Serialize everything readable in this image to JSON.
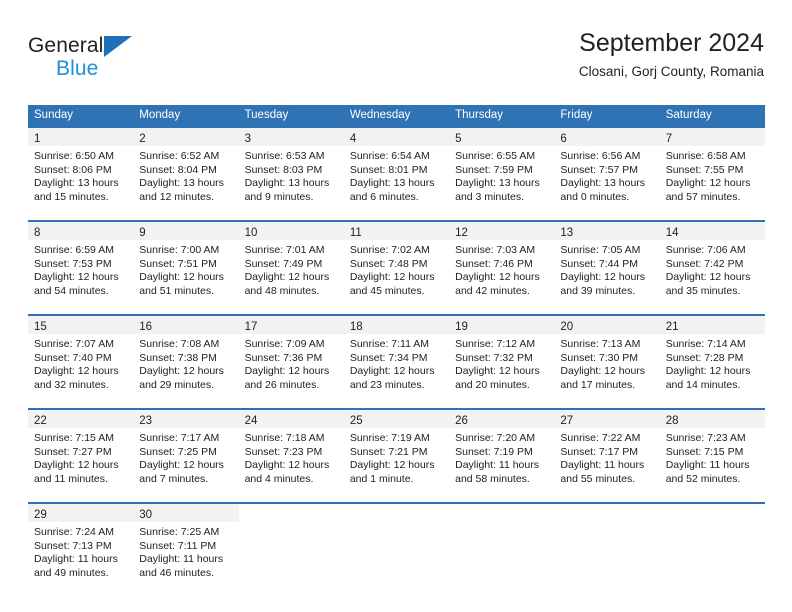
{
  "brand": {
    "name_top": "General",
    "name_bottom": "Blue",
    "triangle_color": "#1d71b8",
    "bottom_color": "#1d8fd6"
  },
  "header": {
    "title": "September 2024",
    "subtitle": "Closani, Gorj County, Romania"
  },
  "theme": {
    "header_blue": "#3073b5",
    "daynum_band": "#f2f2f2",
    "text": "#222222"
  },
  "weekdays": [
    "Sunday",
    "Monday",
    "Tuesday",
    "Wednesday",
    "Thursday",
    "Friday",
    "Saturday"
  ],
  "weeks": [
    [
      {
        "day": "1",
        "sunrise": "Sunrise: 6:50 AM",
        "sunset": "Sunset: 8:06 PM",
        "daylight1": "Daylight: 13 hours",
        "daylight2": "and 15 minutes."
      },
      {
        "day": "2",
        "sunrise": "Sunrise: 6:52 AM",
        "sunset": "Sunset: 8:04 PM",
        "daylight1": "Daylight: 13 hours",
        "daylight2": "and 12 minutes."
      },
      {
        "day": "3",
        "sunrise": "Sunrise: 6:53 AM",
        "sunset": "Sunset: 8:03 PM",
        "daylight1": "Daylight: 13 hours",
        "daylight2": "and 9 minutes."
      },
      {
        "day": "4",
        "sunrise": "Sunrise: 6:54 AM",
        "sunset": "Sunset: 8:01 PM",
        "daylight1": "Daylight: 13 hours",
        "daylight2": "and 6 minutes."
      },
      {
        "day": "5",
        "sunrise": "Sunrise: 6:55 AM",
        "sunset": "Sunset: 7:59 PM",
        "daylight1": "Daylight: 13 hours",
        "daylight2": "and 3 minutes."
      },
      {
        "day": "6",
        "sunrise": "Sunrise: 6:56 AM",
        "sunset": "Sunset: 7:57 PM",
        "daylight1": "Daylight: 13 hours",
        "daylight2": "and 0 minutes."
      },
      {
        "day": "7",
        "sunrise": "Sunrise: 6:58 AM",
        "sunset": "Sunset: 7:55 PM",
        "daylight1": "Daylight: 12 hours",
        "daylight2": "and 57 minutes."
      }
    ],
    [
      {
        "day": "8",
        "sunrise": "Sunrise: 6:59 AM",
        "sunset": "Sunset: 7:53 PM",
        "daylight1": "Daylight: 12 hours",
        "daylight2": "and 54 minutes."
      },
      {
        "day": "9",
        "sunrise": "Sunrise: 7:00 AM",
        "sunset": "Sunset: 7:51 PM",
        "daylight1": "Daylight: 12 hours",
        "daylight2": "and 51 minutes."
      },
      {
        "day": "10",
        "sunrise": "Sunrise: 7:01 AM",
        "sunset": "Sunset: 7:49 PM",
        "daylight1": "Daylight: 12 hours",
        "daylight2": "and 48 minutes."
      },
      {
        "day": "11",
        "sunrise": "Sunrise: 7:02 AM",
        "sunset": "Sunset: 7:48 PM",
        "daylight1": "Daylight: 12 hours",
        "daylight2": "and 45 minutes."
      },
      {
        "day": "12",
        "sunrise": "Sunrise: 7:03 AM",
        "sunset": "Sunset: 7:46 PM",
        "daylight1": "Daylight: 12 hours",
        "daylight2": "and 42 minutes."
      },
      {
        "day": "13",
        "sunrise": "Sunrise: 7:05 AM",
        "sunset": "Sunset: 7:44 PM",
        "daylight1": "Daylight: 12 hours",
        "daylight2": "and 39 minutes."
      },
      {
        "day": "14",
        "sunrise": "Sunrise: 7:06 AM",
        "sunset": "Sunset: 7:42 PM",
        "daylight1": "Daylight: 12 hours",
        "daylight2": "and 35 minutes."
      }
    ],
    [
      {
        "day": "15",
        "sunrise": "Sunrise: 7:07 AM",
        "sunset": "Sunset: 7:40 PM",
        "daylight1": "Daylight: 12 hours",
        "daylight2": "and 32 minutes."
      },
      {
        "day": "16",
        "sunrise": "Sunrise: 7:08 AM",
        "sunset": "Sunset: 7:38 PM",
        "daylight1": "Daylight: 12 hours",
        "daylight2": "and 29 minutes."
      },
      {
        "day": "17",
        "sunrise": "Sunrise: 7:09 AM",
        "sunset": "Sunset: 7:36 PM",
        "daylight1": "Daylight: 12 hours",
        "daylight2": "and 26 minutes."
      },
      {
        "day": "18",
        "sunrise": "Sunrise: 7:11 AM",
        "sunset": "Sunset: 7:34 PM",
        "daylight1": "Daylight: 12 hours",
        "daylight2": "and 23 minutes."
      },
      {
        "day": "19",
        "sunrise": "Sunrise: 7:12 AM",
        "sunset": "Sunset: 7:32 PM",
        "daylight1": "Daylight: 12 hours",
        "daylight2": "and 20 minutes."
      },
      {
        "day": "20",
        "sunrise": "Sunrise: 7:13 AM",
        "sunset": "Sunset: 7:30 PM",
        "daylight1": "Daylight: 12 hours",
        "daylight2": "and 17 minutes."
      },
      {
        "day": "21",
        "sunrise": "Sunrise: 7:14 AM",
        "sunset": "Sunset: 7:28 PM",
        "daylight1": "Daylight: 12 hours",
        "daylight2": "and 14 minutes."
      }
    ],
    [
      {
        "day": "22",
        "sunrise": "Sunrise: 7:15 AM",
        "sunset": "Sunset: 7:27 PM",
        "daylight1": "Daylight: 12 hours",
        "daylight2": "and 11 minutes."
      },
      {
        "day": "23",
        "sunrise": "Sunrise: 7:17 AM",
        "sunset": "Sunset: 7:25 PM",
        "daylight1": "Daylight: 12 hours",
        "daylight2": "and 7 minutes."
      },
      {
        "day": "24",
        "sunrise": "Sunrise: 7:18 AM",
        "sunset": "Sunset: 7:23 PM",
        "daylight1": "Daylight: 12 hours",
        "daylight2": "and 4 minutes."
      },
      {
        "day": "25",
        "sunrise": "Sunrise: 7:19 AM",
        "sunset": "Sunset: 7:21 PM",
        "daylight1": "Daylight: 12 hours",
        "daylight2": "and 1 minute."
      },
      {
        "day": "26",
        "sunrise": "Sunrise: 7:20 AM",
        "sunset": "Sunset: 7:19 PM",
        "daylight1": "Daylight: 11 hours",
        "daylight2": "and 58 minutes."
      },
      {
        "day": "27",
        "sunrise": "Sunrise: 7:22 AM",
        "sunset": "Sunset: 7:17 PM",
        "daylight1": "Daylight: 11 hours",
        "daylight2": "and 55 minutes."
      },
      {
        "day": "28",
        "sunrise": "Sunrise: 7:23 AM",
        "sunset": "Sunset: 7:15 PM",
        "daylight1": "Daylight: 11 hours",
        "daylight2": "and 52 minutes."
      }
    ],
    [
      {
        "day": "29",
        "sunrise": "Sunrise: 7:24 AM",
        "sunset": "Sunset: 7:13 PM",
        "daylight1": "Daylight: 11 hours",
        "daylight2": "and 49 minutes."
      },
      {
        "day": "30",
        "sunrise": "Sunrise: 7:25 AM",
        "sunset": "Sunset: 7:11 PM",
        "daylight1": "Daylight: 11 hours",
        "daylight2": "and 46 minutes."
      },
      {
        "day": "",
        "sunrise": "",
        "sunset": "",
        "daylight1": "",
        "daylight2": ""
      },
      {
        "day": "",
        "sunrise": "",
        "sunset": "",
        "daylight1": "",
        "daylight2": ""
      },
      {
        "day": "",
        "sunrise": "",
        "sunset": "",
        "daylight1": "",
        "daylight2": ""
      },
      {
        "day": "",
        "sunrise": "",
        "sunset": "",
        "daylight1": "",
        "daylight2": ""
      },
      {
        "day": "",
        "sunrise": "",
        "sunset": "",
        "daylight1": "",
        "daylight2": ""
      }
    ]
  ]
}
